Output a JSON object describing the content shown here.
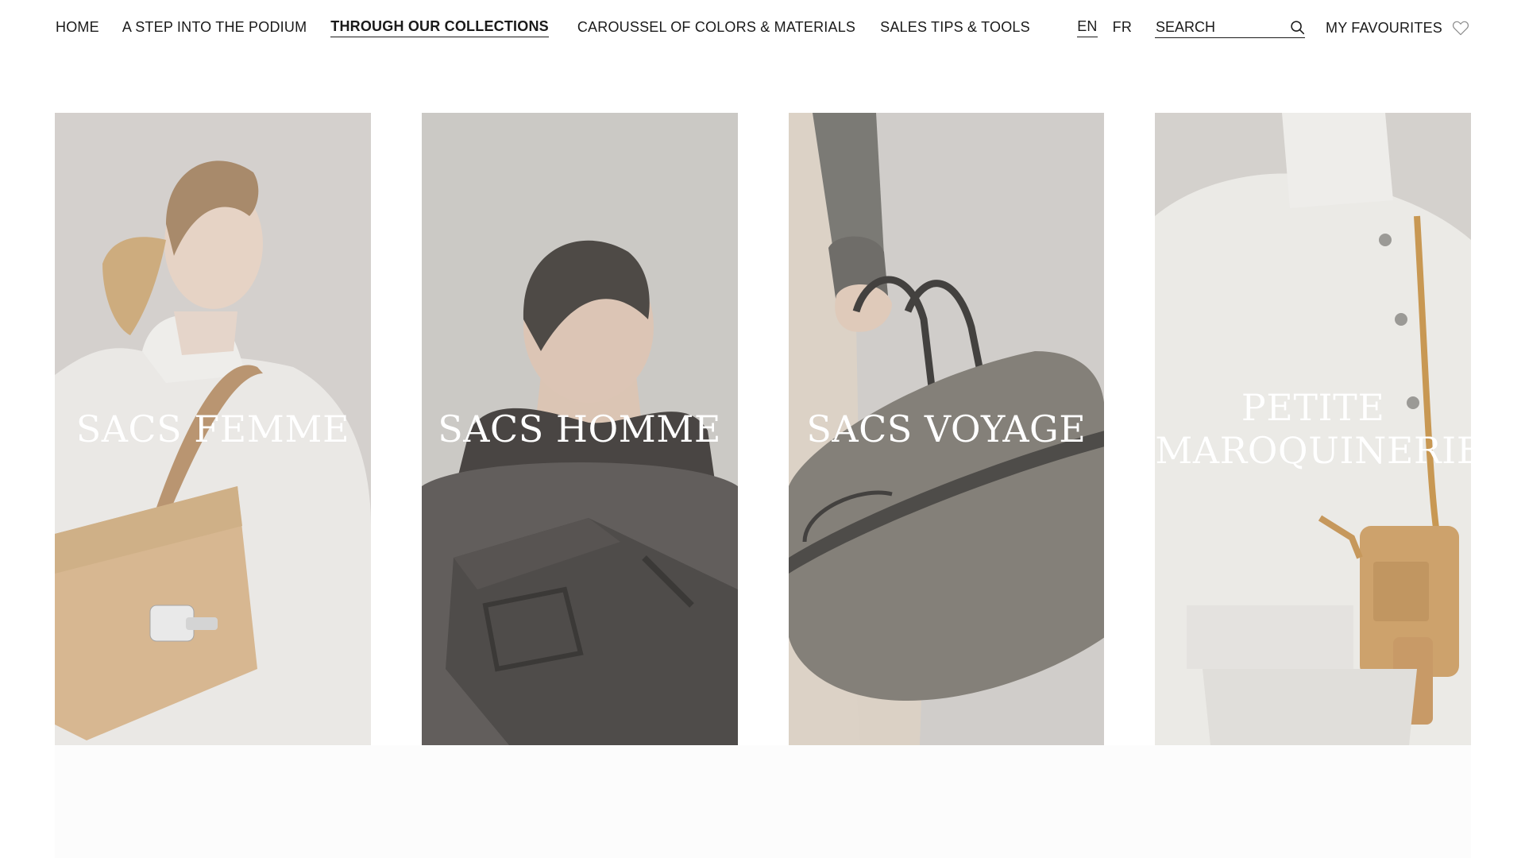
{
  "nav": {
    "items": [
      {
        "label": "HOME"
      },
      {
        "label": "A STEP INTO THE PODIUM"
      },
      {
        "label": "THROUGH OUR COLLECTIONS",
        "active": true
      },
      {
        "label": "CAROUSSEL OF COLORS & MATERIALS"
      },
      {
        "label": "SALES TIPS & TOOLS"
      }
    ],
    "languages": [
      {
        "label": "EN",
        "active": true
      },
      {
        "label": "FR"
      }
    ],
    "search": {
      "placeholder": "SEARCH",
      "value": ""
    },
    "favourites_label": "MY FAVOURITES",
    "icons": {
      "search": "search-icon",
      "favourites": "heart-icon"
    }
  },
  "collections": [
    {
      "title": "SACS FEMME"
    },
    {
      "title": "SACS HOMME"
    },
    {
      "title": "SACS VOYAGE"
    },
    {
      "title": "PETITE MAROQUINERIE"
    }
  ],
  "colors": {
    "text": "#1a1a1a",
    "background": "#ffffff",
    "card_title": "#ffffff"
  }
}
